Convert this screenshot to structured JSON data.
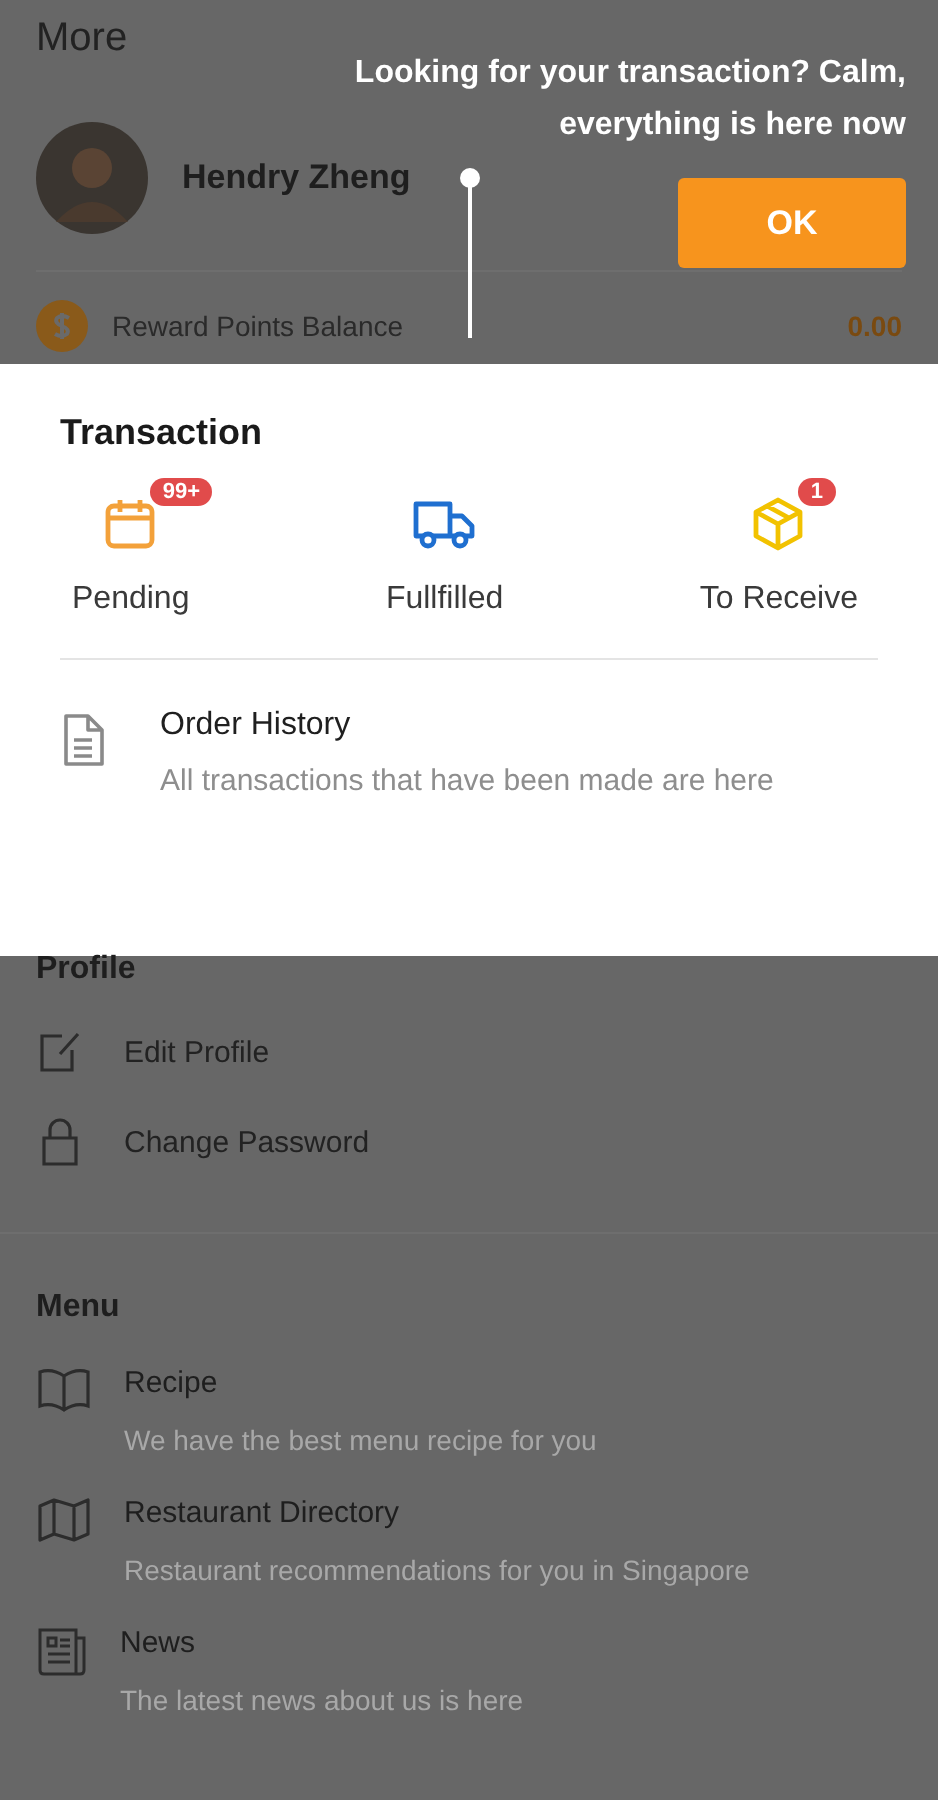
{
  "header": {
    "title": "More"
  },
  "user": {
    "name": "Hendry Zheng"
  },
  "reward": {
    "label": "Reward Points Balance",
    "value": "0.00"
  },
  "coachmark": {
    "message": "Looking for your transaction? Calm, everything is here now",
    "button": "OK"
  },
  "transaction": {
    "title": "Transaction",
    "statuses": [
      {
        "kind": "calendar",
        "label": "Pending",
        "badge": "99+"
      },
      {
        "kind": "truck",
        "label": "Fullfilled"
      },
      {
        "kind": "box",
        "label": "To Receive",
        "badge": "1"
      }
    ],
    "order_history": {
      "title": "Order History",
      "description": "All transactions that have been made are here"
    }
  },
  "profile": {
    "title": "Profile",
    "items": [
      {
        "kind": "edit",
        "label": "Edit Profile"
      },
      {
        "kind": "lock",
        "label": "Change Password"
      }
    ]
  },
  "menu": {
    "title": "Menu",
    "items": [
      {
        "kind": "book",
        "label": "Recipe",
        "description": "We have the best menu recipe for you"
      },
      {
        "kind": "map",
        "label": "Restaurant Directory",
        "description": "Restaurant recommendations for you in Singapore"
      },
      {
        "kind": "news",
        "label": "News",
        "description": "The latest news about us is here"
      }
    ]
  }
}
